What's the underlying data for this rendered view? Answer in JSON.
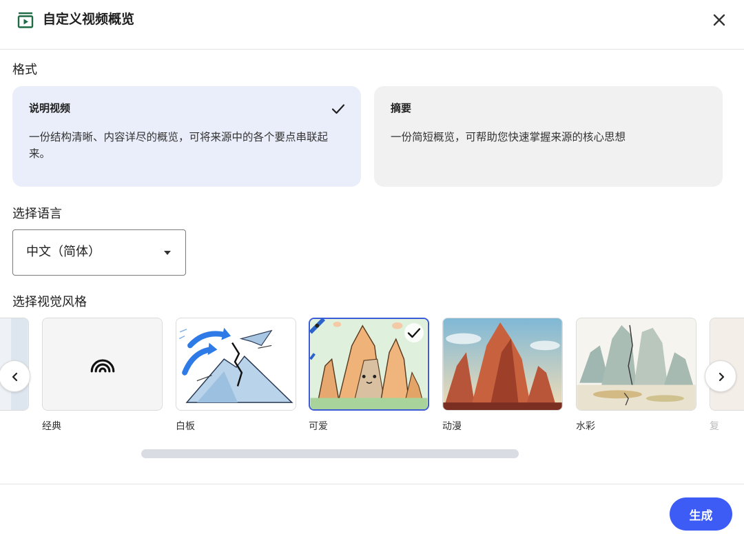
{
  "header": {
    "title": "自定义视频概览",
    "app_icon": "video-overview-icon",
    "close_icon": "close-icon"
  },
  "format": {
    "section_label": "格式",
    "options": [
      {
        "title": "说明视频",
        "description": "一份结构清晰、内容详尽的概览，可将来源中的各个要点串联起来。",
        "selected": true
      },
      {
        "title": "摘要",
        "description": "一份简短概览，可帮助您快速掌握来源的核心思想",
        "selected": false
      }
    ]
  },
  "language": {
    "section_label": "选择语言",
    "selected_value": "中文（简体）"
  },
  "visual_style": {
    "section_label": "选择视觉风格",
    "items": [
      {
        "label": "经典",
        "selected": false
      },
      {
        "label": "白板",
        "selected": false
      },
      {
        "label": "可爱",
        "selected": true
      },
      {
        "label": "动漫",
        "selected": false
      },
      {
        "label": "水彩",
        "selected": false
      },
      {
        "label": "复",
        "selected": false
      }
    ],
    "prev_icon": "chevron-left-icon",
    "next_icon": "chevron-right-icon"
  },
  "footer": {
    "generate_label": "生成"
  },
  "colors": {
    "accent": "#3d5bf5",
    "selected_card_bg": "#eaedfa",
    "card_bg": "#f1f1f1",
    "selected_border": "#3c5bd6"
  }
}
